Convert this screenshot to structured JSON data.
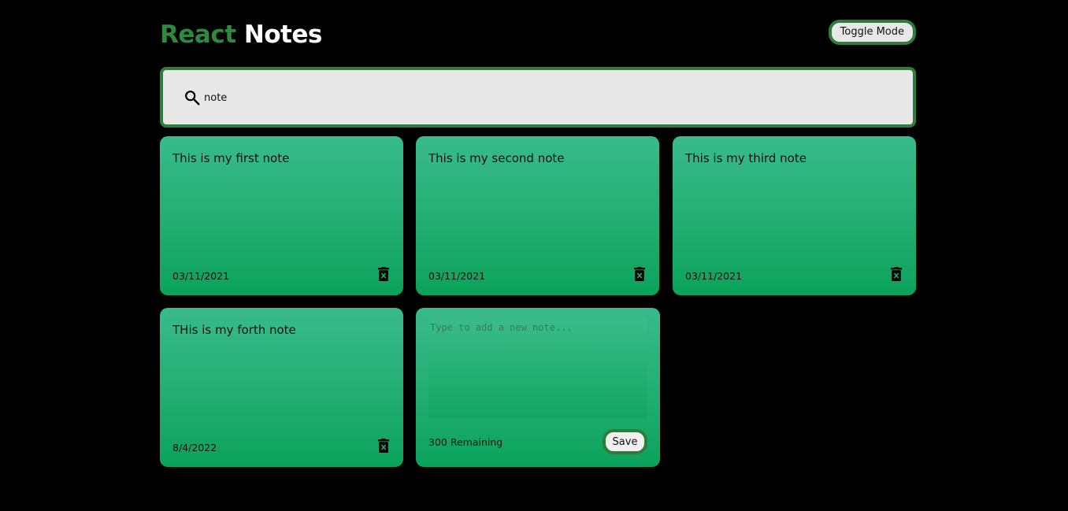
{
  "header": {
    "title_part1": "React",
    "title_part2": "Notes",
    "toggle_label": "Toggle Mode"
  },
  "search": {
    "value": "note",
    "icon": "search-icon"
  },
  "notes": [
    {
      "text": "This is my first note",
      "date": "03/11/2021"
    },
    {
      "text": "This is my second note",
      "date": "03/11/2021"
    },
    {
      "text": "This is my third note",
      "date": "03/11/2021"
    },
    {
      "text": "THis is my forth note",
      "date": "8/4/2022"
    }
  ],
  "new_note": {
    "placeholder": "Type to add a new note...",
    "remaining": "300 Remaining",
    "save_label": "Save"
  },
  "colors": {
    "background": "#000000",
    "accent": "#2e8b3e",
    "note_top": "#38bb8c",
    "note_bottom": "#0aa35b",
    "search_bg": "#e8e8e8"
  }
}
